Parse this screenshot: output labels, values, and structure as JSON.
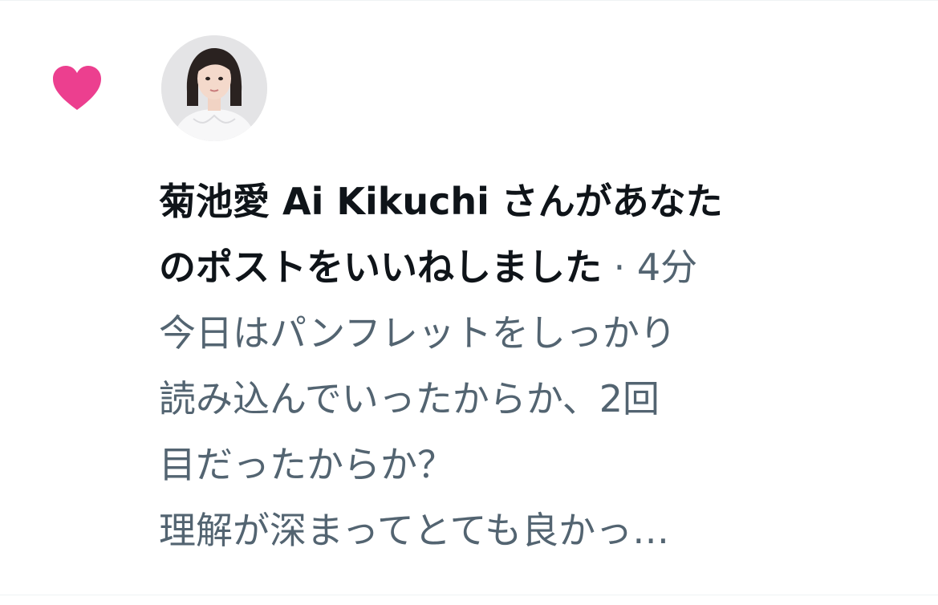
{
  "notification": {
    "type_icon": "heart-icon",
    "accent_color": "#f91880",
    "user_name": "菊池愛 Ai Kikuchi",
    "action_line1": "さんがあなた",
    "action_line2": "のポストをいいねしました",
    "separator": "·",
    "time_ago": "4分",
    "excerpt_lines": [
      "今日はパンフレットをしっかり",
      "読み込んでいったからか、2回",
      "目だったからか？",
      "理解が深まってとても良かっ…"
    ]
  }
}
